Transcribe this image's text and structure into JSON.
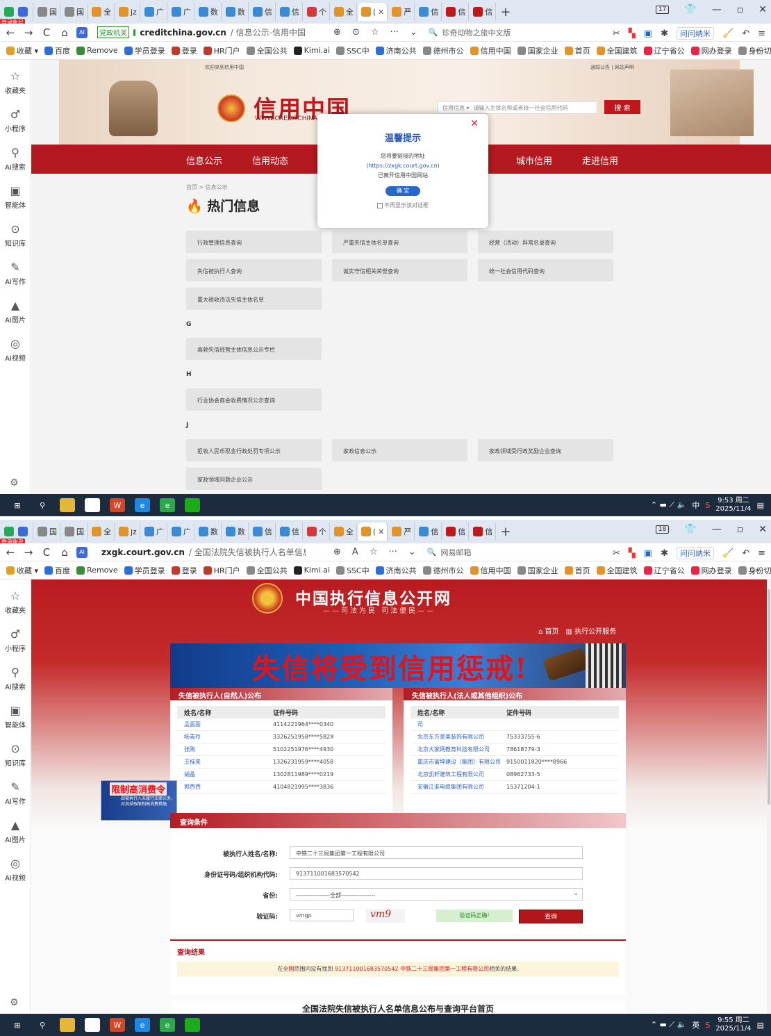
{
  "screen1": {
    "tabs": [
      {
        "label": "",
        "color": "#3a6bd6"
      },
      {
        "label": "国",
        "color": "#888888"
      },
      {
        "label": "国",
        "color": "#888888"
      },
      {
        "label": "全",
        "color": "#e0942a"
      },
      {
        "label": "jz",
        "color": "#e0942a"
      },
      {
        "label": "广",
        "color": "#3a8ad6"
      },
      {
        "label": "广",
        "color": "#3a8ad6"
      },
      {
        "label": "数",
        "color": "#3a8ad6"
      },
      {
        "label": "数",
        "color": "#3a8ad6"
      },
      {
        "label": "信",
        "color": "#3a8ad6"
      },
      {
        "label": "信",
        "color": "#3a8ad6"
      },
      {
        "label": "个",
        "color": "#d23a3a"
      },
      {
        "label": "全",
        "color": "#e0942a"
      },
      {
        "label": "(",
        "color": "#e0942a",
        "active": true
      },
      {
        "label": "严",
        "color": "#e0942a"
      },
      {
        "label": "信",
        "color": "#3a8ad6"
      },
      {
        "label": "信",
        "color": "#c0161c"
      },
      {
        "label": "信",
        "color": "#c0161c"
      }
    ],
    "tab_count": "17",
    "login_badge": "登录账号",
    "url_tag": "党政机关",
    "url_host": "creditchina.gov.cn",
    "url_path": "/ 信息公示-信用中国",
    "search_text": "珍奇动物之旅中文版",
    "ask_label": "问问纳米",
    "taskbar_clock": {
      "time": "9:53 周二",
      "date": "2025/11/4"
    },
    "ime": "中",
    "page": {
      "welcome": "欢迎来到信用中国",
      "top_links": "通知公告 | 网站声明",
      "logo": "信用中国",
      "logo_sub": "WWW.CREDITCHINA.GOV.CN",
      "search_category": "信用信息 ▾",
      "search_placeholder": "请输入主体名称或者统一社会信用代码",
      "search_button": "搜 索",
      "nav": [
        "信息公示",
        "信用动态",
        "城市信用",
        "走进信用"
      ],
      "breadcrumb": "首页 > 信息公示",
      "hot_title": "热门信息",
      "buttons": [
        "行政管理信息查询",
        "严重失信主体名单查询",
        "经营（活动）异常名录查询",
        "失信被执行人查询",
        "诚实守信相关荣誉查询",
        "统一社会信用代码查询",
        "重大税收违法失信主体名单",
        "高频失信经营主体信息公示专栏",
        "行业协会商会收费情况公示查询",
        "拒收人民币现金行政处罚专项公示",
        "家政信息公示",
        "家政领域受行政奖励企业查询",
        "家政领域问题企业公示"
      ],
      "letters": [
        "G",
        "H",
        "J"
      ]
    },
    "dialog": {
      "title": "温馨提示",
      "line1": "您将要链接的地址",
      "line2": "(https://zxgk.court.gov.cn)",
      "line3": "已离开信用中国网站",
      "ok": "确 定",
      "checkbox": "不再显示该对话框"
    }
  },
  "screen2": {
    "tab_count": "18",
    "url_host": "zxgk.court.gov.cn",
    "url_path": "/ 全国法院失信被执行人名单信息公布与",
    "search_text": "网易邮箱",
    "taskbar_clock": {
      "time": "9:55 周二",
      "date": "2025/11/4"
    },
    "ime": "英",
    "page": {
      "site_title": "中国执行信息公开网",
      "motto": "——司法为民  司法便民——",
      "nav_links": [
        "⌂ 首页",
        "▥ 执行公开服务"
      ],
      "banner": "失信将受到信用惩戒!",
      "left_panel": {
        "title": "失信被执行人(自然人)公布",
        "headers": [
          "姓名/名称",
          "证件号码"
        ],
        "rows": [
          [
            "孟面面",
            "4114221964****0340"
          ],
          [
            "杨青玲",
            "3326251958****582X"
          ],
          [
            "张刚",
            "5102251976****4930"
          ],
          [
            "王桂来",
            "1326231959****4058"
          ],
          [
            "胡晶",
            "1302811989****0219"
          ],
          [
            "郭西西",
            "4104821995****3836"
          ]
        ]
      },
      "right_panel": {
        "title": "失信被执行人(法人或其他组织)公布",
        "headers": [
          "姓名/名称",
          "证件号码"
        ],
        "rows": [
          [
            "司",
            ""
          ],
          [
            "北京东方意美装饰有限公司",
            "75333755-6"
          ],
          [
            "北京大家网教育科技有限公司",
            "78618779-3"
          ],
          [
            "重庆市富坤建设（集团）有限公司",
            "9150011820****8966"
          ],
          [
            "北京凯轩建筑工程有限公司",
            "08962733-5"
          ],
          [
            "安徽江淮电缆集团有限公司",
            "15371204-1"
          ]
        ]
      },
      "ad": {
        "title": "限制高消费令",
        "sub": "因被执行人未履行法律义务，对其采取限制高消费措施"
      },
      "query": {
        "title": "查询条件",
        "name_label": "被执行人姓名/名称:",
        "name_value": "中铁二十三局集团第一工程有限公司",
        "id_label": "身份证号码/组织机构代码:",
        "id_value": "913711001683570542",
        "province_label": "省份:",
        "province_value": "-----------------全部-----------------",
        "captcha_label": "验证码:",
        "captcha_value": "vmgp",
        "captcha_image": "vm9",
        "captcha_ok": "验证码正确!",
        "search_button": "查询"
      },
      "result": {
        "title": "查询结果",
        "p1": "在",
        "p2": "全国",
        "p3": "范围内没有找到 ",
        "p4": "913711001683570542 中铁二十三局集团第一工程有限公司",
        "p5": "相关的结果."
      },
      "footer_title": "全国法院失信被执行人名单信息公布与查询平台首页"
    }
  },
  "shared": {
    "bookmarks": [
      "收藏 ▾",
      "百度",
      "Remove",
      "学员登录",
      "登录",
      "HR门户",
      "全国公共",
      "Kimi.ai",
      "SSC中",
      "济南公共",
      "德州市公",
      "信用中国",
      "国家企业",
      "首页",
      "全国建筑",
      "辽宁省公",
      "网办登录",
      "身份切换"
    ],
    "bookmark_more": "»",
    "sidebar": [
      "收藏夹",
      "小程序",
      "AI搜索",
      "智能体",
      "知识库",
      "AI写作",
      "AI图片",
      "AI视频"
    ]
  }
}
